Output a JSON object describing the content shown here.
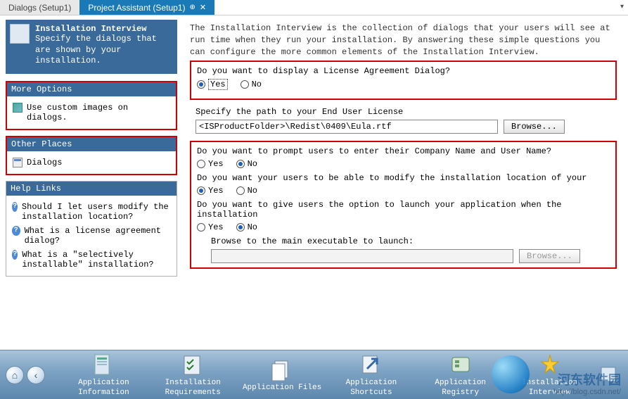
{
  "tabs": {
    "inactive": "Dialogs (Setup1)",
    "active": "Project Assistant (Setup1)"
  },
  "header": {
    "title": "Installation Interview",
    "subtitle": "Specify the dialogs that are shown by your installation."
  },
  "moreOptions": {
    "title": "More Options",
    "items": [
      "Use custom images on dialogs."
    ]
  },
  "otherPlaces": {
    "title": "Other Places",
    "items": [
      "Dialogs"
    ]
  },
  "helpLinks": {
    "title": "Help Links",
    "items": [
      "Should I let users modify the installation location?",
      "What is a license agreement dialog?",
      "What is a \"selectively installable\" installation?"
    ]
  },
  "content": {
    "intro": "The Installation Interview is the collection of dialogs that your users will see at run time when they run your installation. By answering these simple questions you can configure the more common elements of the Installation Interview.",
    "q1": "Do you want to display a License Agreement Dialog?",
    "yes": "Yes",
    "no": "No",
    "specifyPath": "Specify the path to your End User License",
    "eulaPath": "<ISProductFolder>\\Redist\\0409\\Eula.rtf",
    "browse": "Browse...",
    "q2": "Do you want to prompt users to enter their Company Name and User Name?",
    "q3": "Do you want your users to be able to modify the installation location of your",
    "q4": "Do you want to give users the option to launch your application when the installation",
    "browseExe": "Browse to the main executable to launch:"
  },
  "bottom": {
    "items": [
      "Application Information",
      "Installation Requirements",
      "Application Files",
      "Application Shortcuts",
      "Application Registry",
      "Installation Interview"
    ]
  },
  "watermark": {
    "text": "河东软件园",
    "url": "http://blog.csdn.net/"
  }
}
